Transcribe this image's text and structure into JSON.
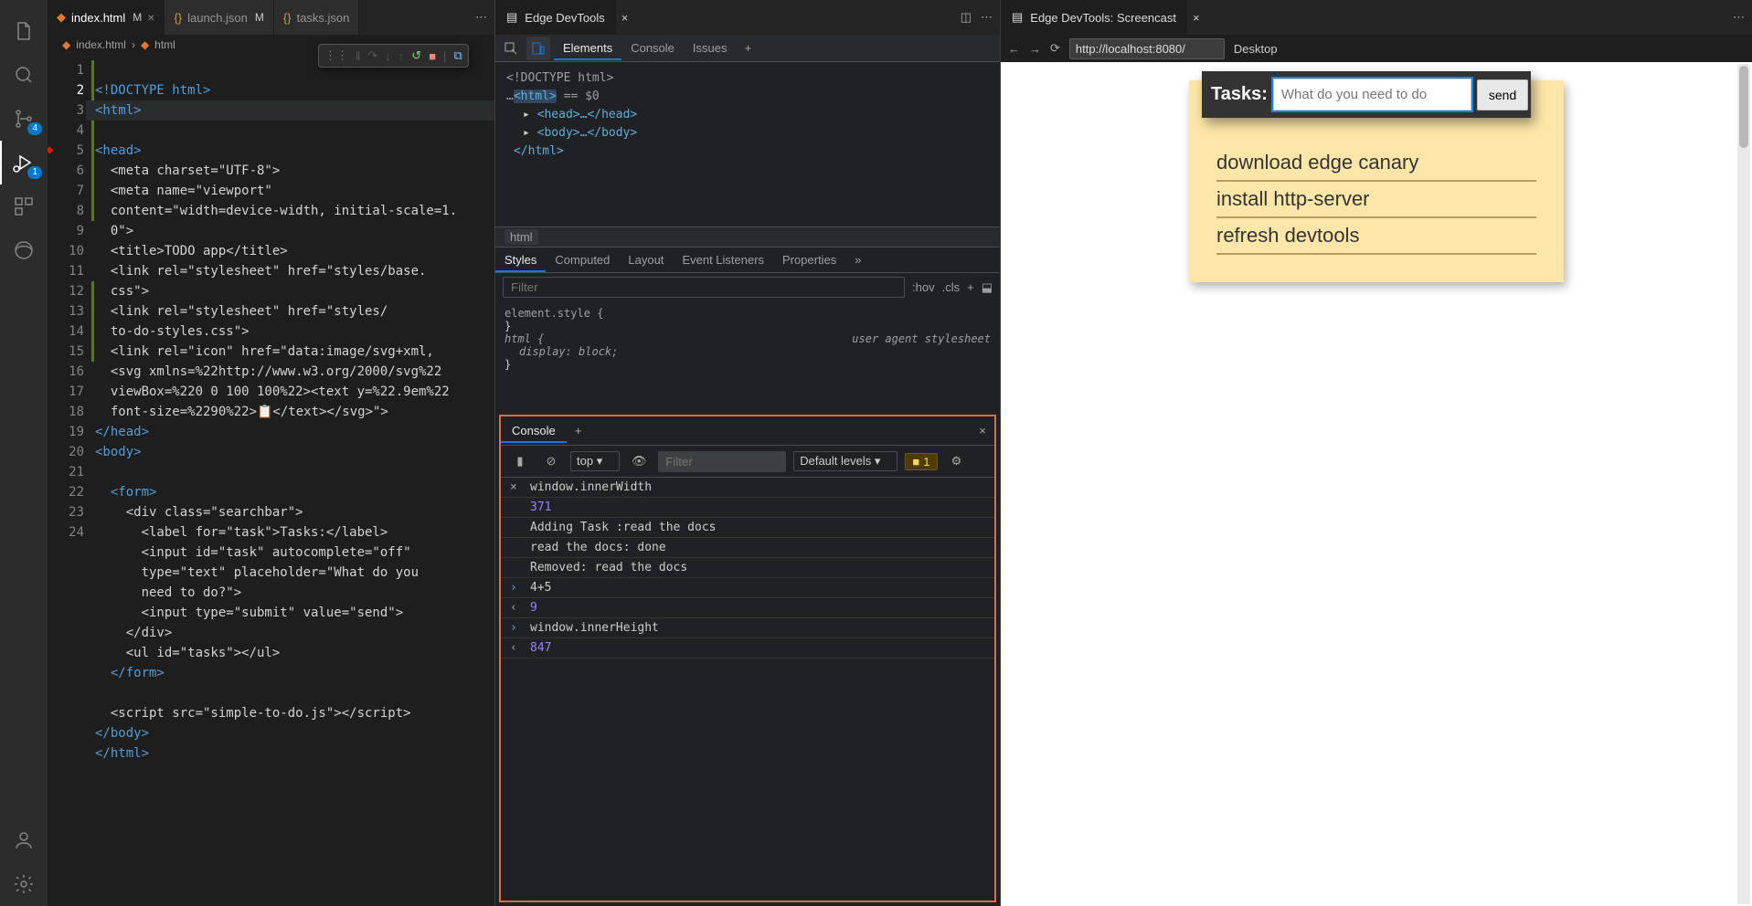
{
  "activityBadges": {
    "scm": "4",
    "debug": "1"
  },
  "tabs": [
    {
      "label": "index.html",
      "modified": "M",
      "active": true,
      "icon": "html"
    },
    {
      "label": "launch.json",
      "modified": "M",
      "active": false,
      "icon": "json"
    },
    {
      "label": "tasks.json",
      "modified": "",
      "active": false,
      "icon": "json"
    }
  ],
  "breadcrumb": {
    "file": "index.html",
    "tag": "html"
  },
  "gutter": [
    "1",
    "2",
    "3",
    "4",
    "5",
    "6",
    "7",
    "8",
    "9",
    "10",
    "11",
    "12",
    "13",
    "14",
    "15",
    "16",
    "17",
    "18",
    "19",
    "20",
    "21",
    "22",
    "23",
    "24"
  ],
  "code": {
    "l1": "<!DOCTYPE html>",
    "l2": "<html>",
    "l3": "<head>",
    "l4": "  <meta charset=\"UTF-8\">",
    "l5a": "  <meta name=\"viewport\"",
    "l5b": "  content=\"width=device-width, initial-scale=1.",
    "l5c": "  0\">",
    "l6": "  <title>TODO app</title>",
    "l7a": "  <link rel=\"stylesheet\" href=\"styles/base.",
    "l7b": "  css\">",
    "l8a": "  <link rel=\"stylesheet\" href=\"styles/",
    "l8b": "  to-do-styles.css\">",
    "l9a": "  <link rel=\"icon\" href=\"data:image/svg+xml,",
    "l9b": "  <svg xmlns=%22http://www.w3.org/2000/svg%22 ",
    "l9c": "  viewBox=%220 0 100 100%22><text y=%22.9em%22 ",
    "l9d": "  font-size=%2290%22>📋</text></svg>\">",
    "l10": "</head>",
    "l11": "<body>",
    "l12": "",
    "l13": "  <form>",
    "l14": "    <div class=\"searchbar\">",
    "l15": "      <label for=\"task\">Tasks:</label>",
    "l16a": "      <input id=\"task\" autocomplete=\"off\" ",
    "l16b": "      type=\"text\" placeholder=\"What do you ",
    "l16c": "      need to do?\">",
    "l17": "      <input type=\"submit\" value=\"send\">",
    "l18": "    </div>",
    "l19": "    <ul id=\"tasks\"></ul>",
    "l20": "  </form>",
    "l21": "",
    "l22": "  <script src=\"simple-to-do.js\"></script>",
    "l23": "</body>",
    "l24": "</html>"
  },
  "devtools": {
    "title": "Edge DevTools",
    "mainTabs": [
      "Elements",
      "Console",
      "Issues"
    ],
    "dom": {
      "doctype": "<!DOCTYPE html>",
      "html_open": "<html>",
      "eq": " == $0",
      "head": "<head>…</head>",
      "body": "<body>…</body>",
      "html_close": "</html>"
    },
    "breadcrumb": "html",
    "styleTabs": [
      "Styles",
      "Computed",
      "Layout",
      "Event Listeners",
      "Properties"
    ],
    "filterPh": "Filter",
    "hov": ":hov",
    "cls": ".cls",
    "css": {
      "elsty": "element.style {",
      "brace": "}",
      "sel": "html {",
      "prop": "display",
      "val": "block",
      "semi": ";",
      "ua": "user agent stylesheet"
    },
    "drawer": {
      "tab": "Console",
      "ctx": "top",
      "filterPh": "Filter",
      "levels": "Default levels",
      "issueCount": "1",
      "rows": [
        {
          "type": "inclear",
          "text": "window.innerWidth"
        },
        {
          "type": "num",
          "text": "371"
        },
        {
          "type": "log",
          "text": "Adding Task :read the docs"
        },
        {
          "type": "log",
          "text": "read the docs: done"
        },
        {
          "type": "log",
          "text": "Removed: read the docs"
        },
        {
          "type": "in",
          "text": "4+5"
        },
        {
          "type": "outnum",
          "text": "9"
        },
        {
          "type": "in",
          "text": "window.innerHeight"
        },
        {
          "type": "outnum",
          "text": "847"
        }
      ]
    }
  },
  "screencast": {
    "title": "Edge DevTools: Screencast",
    "url": "http://localhost:8080/",
    "mode": "Desktop",
    "taskLabel": "Tasks:",
    "taskPlaceholder": "What do you need to do",
    "send": "send",
    "items": [
      "download edge canary",
      "install http-server",
      "refresh devtools"
    ]
  }
}
